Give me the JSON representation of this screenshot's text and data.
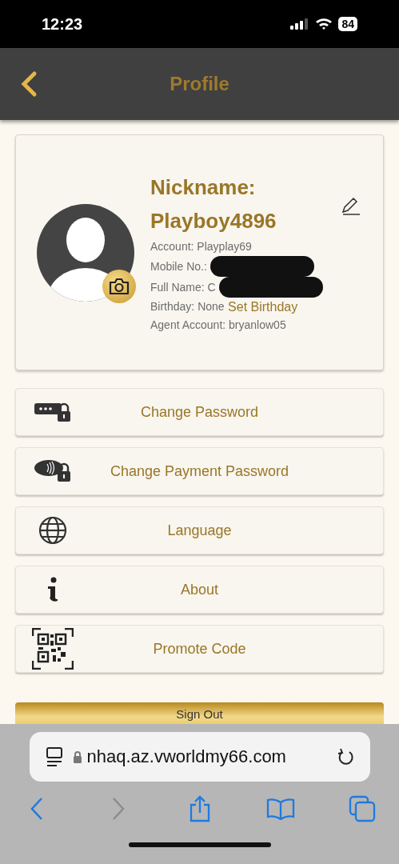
{
  "status_bar": {
    "time": "12:23",
    "battery": "84"
  },
  "header": {
    "title": "Profile"
  },
  "profile": {
    "nickname_label": "Nickname:",
    "nickname": "Playboy4896",
    "fields": [
      {
        "text": "Account: Playplay69",
        "redacted": false
      },
      {
        "text": "Mobile No.:",
        "redacted": true
      },
      {
        "text": "Full Name: C",
        "redacted": true
      },
      {
        "text": "Birthday: None",
        "link": "Set Birthday",
        "redacted": false
      },
      {
        "text": "Agent Account: bryanlow05",
        "redacted": false
      }
    ]
  },
  "menu": [
    {
      "kind": "password",
      "label": "Change Password"
    },
    {
      "kind": "payment",
      "label": "Change Payment Password"
    },
    {
      "kind": "globe",
      "label": "Language"
    },
    {
      "kind": "info",
      "label": "About"
    },
    {
      "kind": "qr",
      "label": "Promote Code"
    }
  ],
  "sign_out": "Sign Out",
  "browser": {
    "url": "nhaq.az.vworldmy66.com"
  }
}
